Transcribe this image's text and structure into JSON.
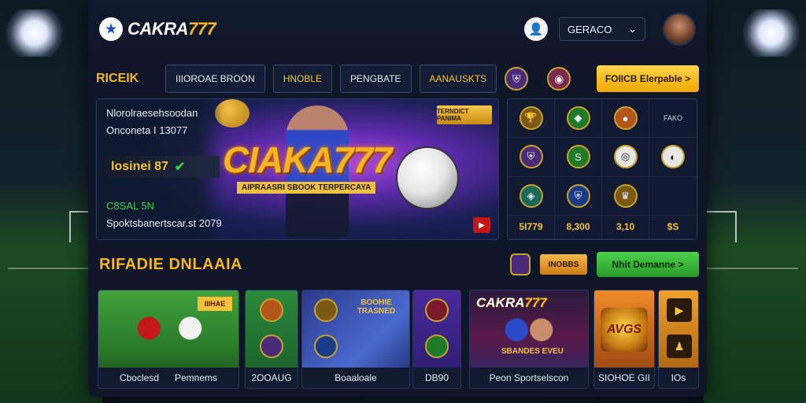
{
  "header": {
    "logo_text": "CAKRA",
    "logo_num": "777",
    "lang_value": "GERACO"
  },
  "nav": {
    "brand": "RICEIK",
    "items": [
      "IIIOROAE BROON",
      "HNOBLE",
      "PENGBATE",
      "AANAUSKTS"
    ],
    "promo": "FOIICB Elerpable >"
  },
  "hero": {
    "line1": "Nlorolraesehsoodan",
    "line2": "Onconeta I 13077",
    "bonus": "losinei 87",
    "title": "CIAKA777",
    "subtitle": "AIPRAASRI SBOOK TERPERCAYA",
    "badge": "TERNDICT PANIMA",
    "tag": "C8SAL 5N",
    "footer": "Spoktsbanertscar.st 2079"
  },
  "side_grid": {
    "values": [
      "5I779",
      "8,300",
      "3,10",
      "$S"
    ],
    "label": "FAKO"
  },
  "section": {
    "title": "RIFADIE DNLAAIA",
    "tag": "INOBBS",
    "button": "Nhit Demanne >"
  },
  "cards": {
    "c1_tag": "IIIHAE",
    "c1_labels": [
      "Cboclesd",
      "Pemnems"
    ],
    "c2_label": "2OOAUG",
    "c3_title": "BOOHIE TRASNED",
    "c3_label": "Boaaloale",
    "c4_label": "DB90",
    "c5_title_a": "CAKRA",
    "c5_title_b": "777",
    "c5_sub": "SBANDES EVEU",
    "c5_label": "Peon Sportselscon",
    "c6_logo": "AVGS",
    "c6_label": "SIOHOE GII",
    "c7_label": "IOs"
  },
  "colors": {
    "accent": "#f4b623",
    "panel": "#0f1628",
    "green_button": "#4cd14a"
  }
}
